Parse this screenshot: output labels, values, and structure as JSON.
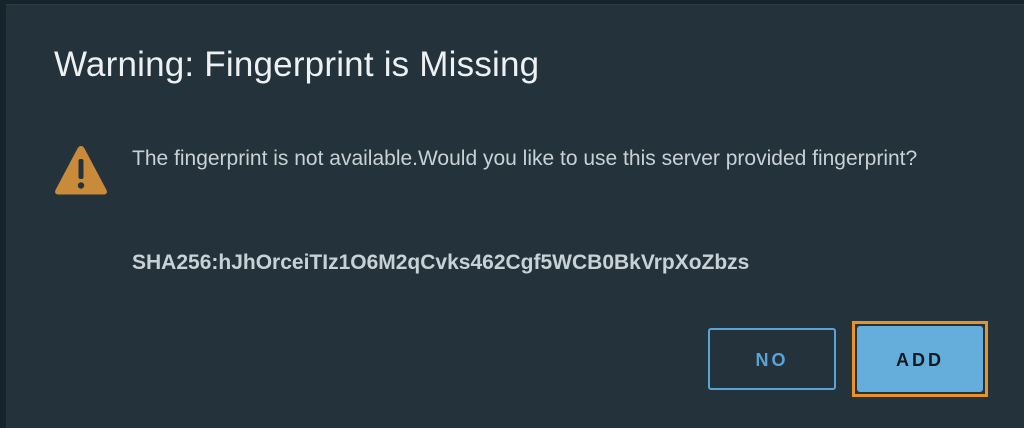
{
  "dialog": {
    "title": "Warning: Fingerprint is Missing",
    "icon": "warning-triangle-icon",
    "message": "The fingerprint is not available.Would you like to use this server provided fingerprint?",
    "fingerprint": "SHA256:hJhOrceiTIz1O6M2qCvks462Cgf5WCB0BkVrpXoZbzs"
  },
  "buttons": {
    "no_label": "NO",
    "add_label": "ADD"
  },
  "colors": {
    "background": "#24333b",
    "warning": "#c98a3a",
    "primary": "#65aedb",
    "focus_ring": "#e8922a",
    "outline_button": "#5aa3d6"
  }
}
